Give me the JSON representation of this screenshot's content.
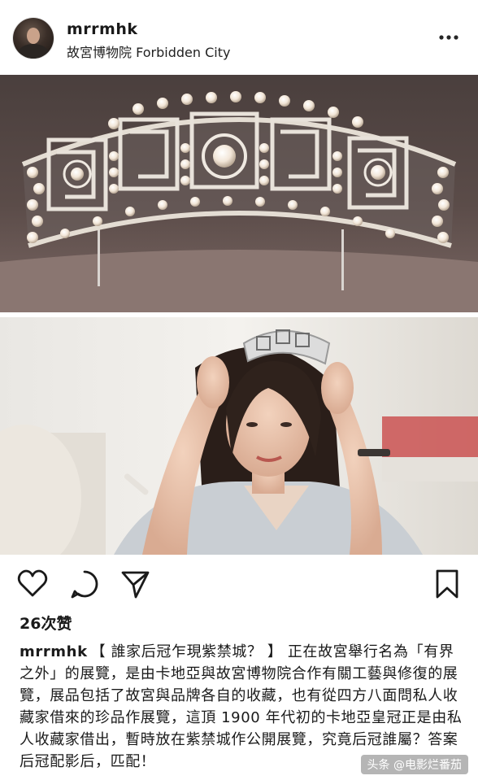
{
  "post": {
    "username": "mrrmhk",
    "location": "故宮博物院 Forbidden City",
    "likes": "26次赞",
    "caption_user": "mrrmhk",
    "caption_text": "【 誰家后冠乍現紫禁城？ 】 正在故宮舉行名為「有界之外」的展覽，是由卡地亞與故宮博物院合作有關工藝與修復的展覽，展品包括了故宮與品牌各自的收藏，也有從四方八面問私人收藏家借來的珍品作展覽，這頂 1900 年代初的卡地亞皇冠正是由私人收藏家借出，暫時放在紫禁城作公開展覽，究竟后冠誰屬？答案后冠配影后，匹配！"
  },
  "icons": {
    "more": "more-dots-icon",
    "like": "heart-icon",
    "comment": "comment-icon",
    "share": "send-icon",
    "save": "bookmark-icon"
  },
  "watermark": {
    "text": "头条 @电影烂番茄"
  },
  "colors": {
    "text": "#1a1a1a",
    "background": "#ffffff"
  }
}
